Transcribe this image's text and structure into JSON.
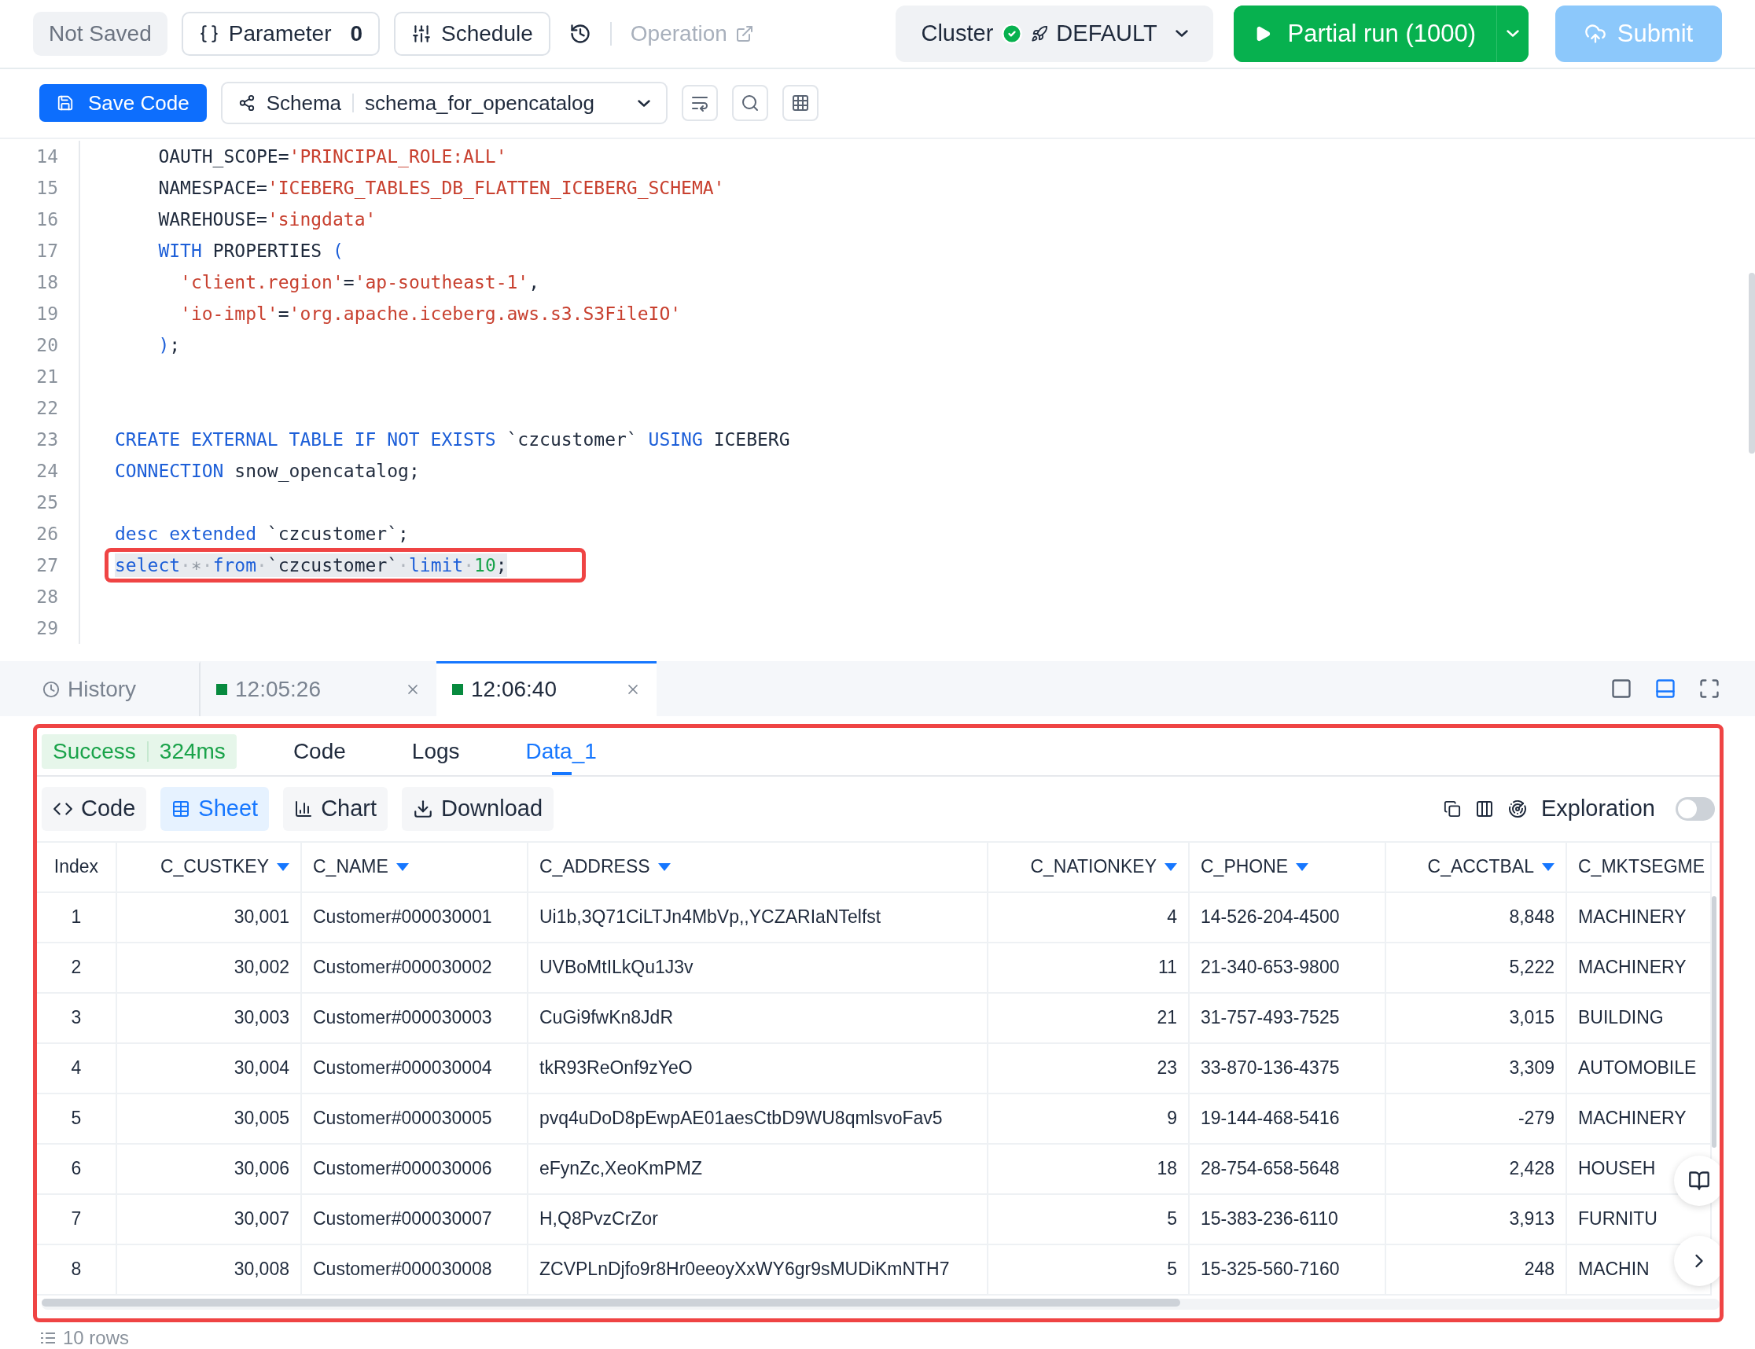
{
  "top_bar": {
    "save_status": "Not Saved",
    "parameter": {
      "label": "Parameter",
      "count": "0"
    },
    "schedule": "Schedule",
    "operation": {
      "label": "Operation",
      "disabled": true
    },
    "cluster": {
      "label": "Cluster",
      "healthy": true,
      "name": "DEFAULT"
    },
    "run_button": "Partial run (1000)",
    "submit": {
      "label": "Submit",
      "disabled": true
    }
  },
  "editor_toolbar": {
    "save_button": "Save Code",
    "schema": {
      "label": "Schema",
      "value": "schema_for_opencatalog"
    }
  },
  "editor": {
    "lines": [
      {
        "number": "14",
        "highlighted": false,
        "tokens": [
          {
            "kind": "text",
            "text": "    OAUTH_SCOPE="
          },
          {
            "kind": "str",
            "text": "'PRINCIPAL_ROLE:ALL'"
          }
        ]
      },
      {
        "number": "15",
        "highlighted": false,
        "tokens": [
          {
            "kind": "text",
            "text": "    NAMESPACE="
          },
          {
            "kind": "str",
            "text": "'ICEBERG_TABLES_DB_FLATTEN_ICEBERG_SCHEMA'"
          }
        ]
      },
      {
        "number": "16",
        "highlighted": false,
        "tokens": [
          {
            "kind": "text",
            "text": "    WAREHOUSE="
          },
          {
            "kind": "str",
            "text": "'singdata'"
          }
        ]
      },
      {
        "number": "17",
        "highlighted": false,
        "tokens": [
          {
            "kind": "kw",
            "text": "    WITH"
          },
          {
            "kind": "text",
            "text": " PROPERTIES "
          },
          {
            "kind": "kw",
            "text": "("
          }
        ]
      },
      {
        "number": "18",
        "highlighted": false,
        "tokens": [
          {
            "kind": "str",
            "text": "      'client.region'"
          },
          {
            "kind": "text",
            "text": "="
          },
          {
            "kind": "str",
            "text": "'ap-southeast-1'"
          },
          {
            "kind": "text",
            "text": ","
          }
        ]
      },
      {
        "number": "19",
        "highlighted": false,
        "tokens": [
          {
            "kind": "str",
            "text": "      'io-impl'"
          },
          {
            "kind": "text",
            "text": "="
          },
          {
            "kind": "str",
            "text": "'org.apache.iceberg.aws.s3.S3FileIO'"
          }
        ]
      },
      {
        "number": "20",
        "highlighted": false,
        "tokens": [
          {
            "kind": "kw",
            "text": "    )"
          },
          {
            "kind": "text",
            "text": ";"
          }
        ]
      },
      {
        "number": "21",
        "highlighted": false
      },
      {
        "number": "22",
        "highlighted": false
      },
      {
        "number": "23",
        "highlighted": false,
        "tokens": [
          {
            "kind": "kw",
            "text": "CREATE EXTERNAL TABLE IF NOT EXISTS"
          },
          {
            "kind": "text",
            "text": " `czcustomer` "
          },
          {
            "kind": "kw",
            "text": "USING"
          },
          {
            "kind": "text",
            "text": " ICEBERG"
          }
        ]
      },
      {
        "number": "24",
        "highlighted": false,
        "tokens": [
          {
            "kind": "kw",
            "text": "CONNECTION"
          },
          {
            "kind": "text",
            "text": " snow_opencatalog;"
          }
        ]
      },
      {
        "number": "25",
        "highlighted": false
      },
      {
        "number": "26",
        "highlighted": false,
        "tokens": [
          {
            "kind": "kw",
            "text": "desc extended"
          },
          {
            "kind": "text",
            "text": " `czcustomer`;"
          }
        ]
      },
      {
        "number": "27",
        "highlighted": true,
        "tokens": [
          {
            "kind": "kw",
            "text": "select"
          },
          {
            "kind": "ws",
            "text": "·"
          },
          {
            "kind": "muted",
            "text": "∗"
          },
          {
            "kind": "ws",
            "text": "·"
          },
          {
            "kind": "kw",
            "text": "from"
          },
          {
            "kind": "ws",
            "text": "·"
          },
          {
            "kind": "text",
            "text": "`czcustomer`"
          },
          {
            "kind": "ws",
            "text": "·"
          },
          {
            "kind": "kw",
            "text": "limit"
          },
          {
            "kind": "ws",
            "text": "·"
          },
          {
            "kind": "num",
            "text": "10"
          },
          {
            "kind": "text",
            "text": ";"
          }
        ]
      },
      {
        "number": "28",
        "highlighted": false
      },
      {
        "number": "29",
        "highlighted": false
      }
    ]
  },
  "run_tabs": [
    {
      "kind": "history",
      "label": "History",
      "selected": false
    },
    {
      "kind": "run",
      "label": "12:05:26",
      "selected": false
    },
    {
      "kind": "run",
      "label": "12:06:40",
      "selected": true
    }
  ],
  "layout_buttons": [
    {
      "kind": "bottom",
      "selected": false
    },
    {
      "kind": "split",
      "selected": true
    },
    {
      "kind": "full",
      "selected": false
    }
  ],
  "result": {
    "status": "Success",
    "duration": "324ms",
    "tabs": [
      {
        "label": "Code",
        "selected": false
      },
      {
        "label": "Logs",
        "selected": false
      },
      {
        "label": "Data_1",
        "selected": true
      }
    ],
    "views": [
      {
        "kind": "code",
        "label": "Code",
        "selected": false
      },
      {
        "kind": "sheet",
        "label": "Sheet",
        "selected": true
      },
      {
        "kind": "chart",
        "label": "Chart",
        "selected": false
      },
      {
        "kind": "download",
        "label": "Download",
        "selected": false
      }
    ],
    "exploration": {
      "label": "Exploration",
      "on": false
    },
    "table": {
      "columns": [
        {
          "label": "Index",
          "sortable": false
        },
        {
          "label": "C_CUSTKEY",
          "sortable": true
        },
        {
          "label": "C_NAME",
          "sortable": true
        },
        {
          "label": "C_ADDRESS",
          "sortable": true
        },
        {
          "label": "C_NATIONKEY",
          "sortable": true
        },
        {
          "label": "C_PHONE",
          "sortable": true
        },
        {
          "label": "C_ACCTBAL",
          "sortable": true
        },
        {
          "label": "C_MKTSEGME"
        }
      ],
      "rows": [
        [
          "1",
          "30,001",
          "Customer#000030001",
          "Ui1b,3Q71CiLTJn4MbVp,,YCZARIaNTelfst",
          "4",
          "14-526-204-4500",
          "8,848",
          "MACHINERY"
        ],
        [
          "2",
          "30,002",
          "Customer#000030002",
          "UVBoMtILkQu1J3v",
          "11",
          "21-340-653-9800",
          "5,222",
          "MACHINERY"
        ],
        [
          "3",
          "30,003",
          "Customer#000030003",
          "CuGi9fwKn8JdR",
          "21",
          "31-757-493-7525",
          "3,015",
          "BUILDING"
        ],
        [
          "4",
          "30,004",
          "Customer#000030004",
          "tkR93ReOnf9zYeO",
          "23",
          "33-870-136-4375",
          "3,309",
          "AUTOMOBILE"
        ],
        [
          "5",
          "30,005",
          "Customer#000030005",
          "pvq4uDoD8pEwpAE01aesCtbD9WU8qmlsvoFav5",
          "9",
          "19-144-468-5416",
          "-279",
          "MACHINERY"
        ],
        [
          "6",
          "30,006",
          "Customer#000030006",
          "eFynZc,XeoKmPMZ",
          "18",
          "28-754-658-5648",
          "2,428",
          "HOUSEH"
        ],
        [
          "7",
          "30,007",
          "Customer#000030007",
          "H,Q8PvzCrZor",
          "5",
          "15-383-236-6110",
          "3,913",
          "FURNITU"
        ],
        [
          "8",
          "30,008",
          "Customer#000030008",
          "ZCVPLnDjfo9r8Hr0eeoyXxWY6gr9sMUDiKmNTH7",
          "5",
          "15-325-560-7160",
          "248",
          "MACHIN"
        ]
      ]
    },
    "row_count": "10 rows"
  }
}
